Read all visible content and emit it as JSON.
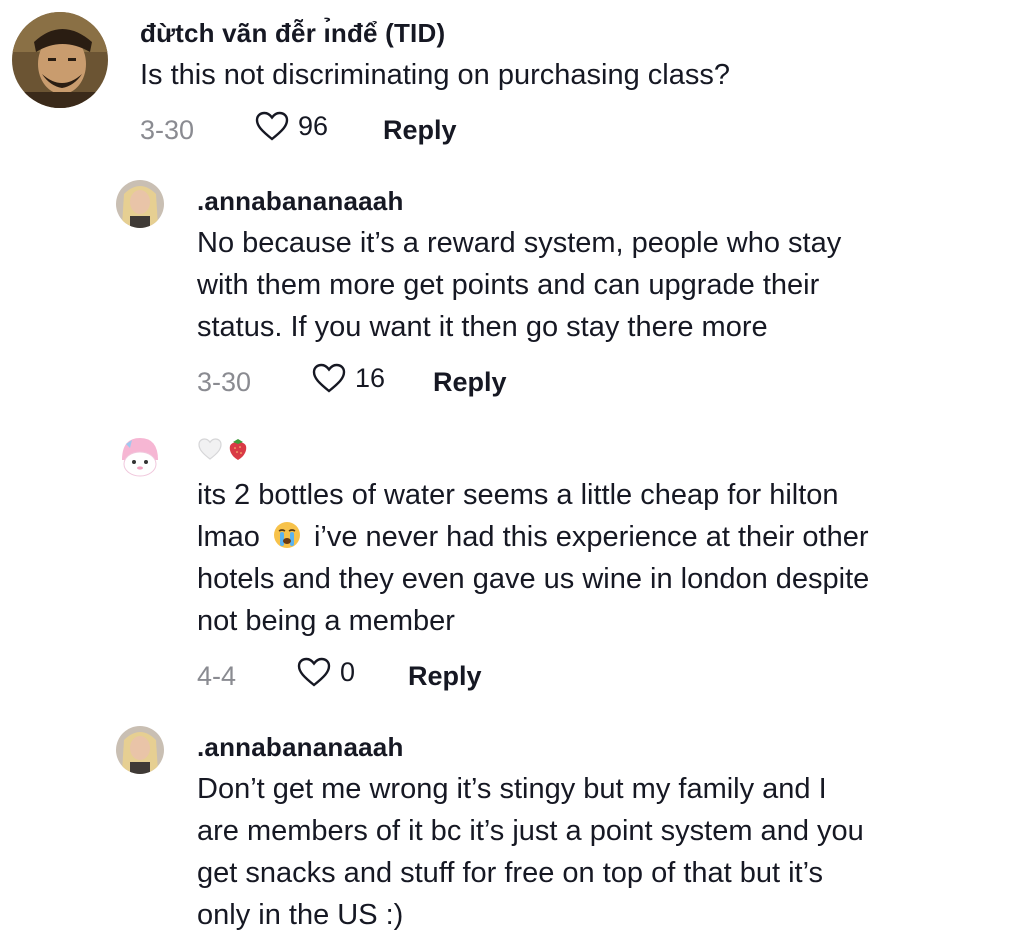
{
  "comments": [
    {
      "username": "đừtch vã̃n đễr ı̉nđể (TID)",
      "lines": [
        "Is this not discriminating on purchasing class?"
      ],
      "date": "3-30",
      "likes": "96",
      "reply_label": "Reply",
      "avatar_icon": "user-avatar-portrait"
    },
    {
      "username": ".annabananaaah",
      "lines": [
        "No because it’s a reward system, people who stay",
        "with them more get points and can upgrade their",
        "status. If you want it then go stay there more"
      ],
      "date": "3-30",
      "likes": "16",
      "reply_label": "Reply",
      "avatar_icon": "user-avatar-photo"
    },
    {
      "username_icons": [
        "white-heart-icon",
        "strawberry-icon"
      ],
      "lines": [
        "its 2 bottles of water seems a little cheap for hilton",
        "lmao",
        "i’ve never had this experience at their other",
        "hotels and they even gave us wine in london despite",
        "not being a member"
      ],
      "date": "4-4",
      "likes": "0",
      "reply_label": "Reply",
      "avatar_icon": "user-avatar-cartoon"
    },
    {
      "username": ".annabananaaah",
      "lines": [
        "Don’t get me wrong it’s stingy but my family and I",
        "are members of it bc it’s just a point system and you",
        "get snacks and stuff for free on top of that but it’s",
        "only in the US :)"
      ],
      "avatar_icon": "user-avatar-photo"
    }
  ],
  "colors": {
    "text": "#161823",
    "muted": "#8a8b91",
    "background": "#ffffff"
  }
}
